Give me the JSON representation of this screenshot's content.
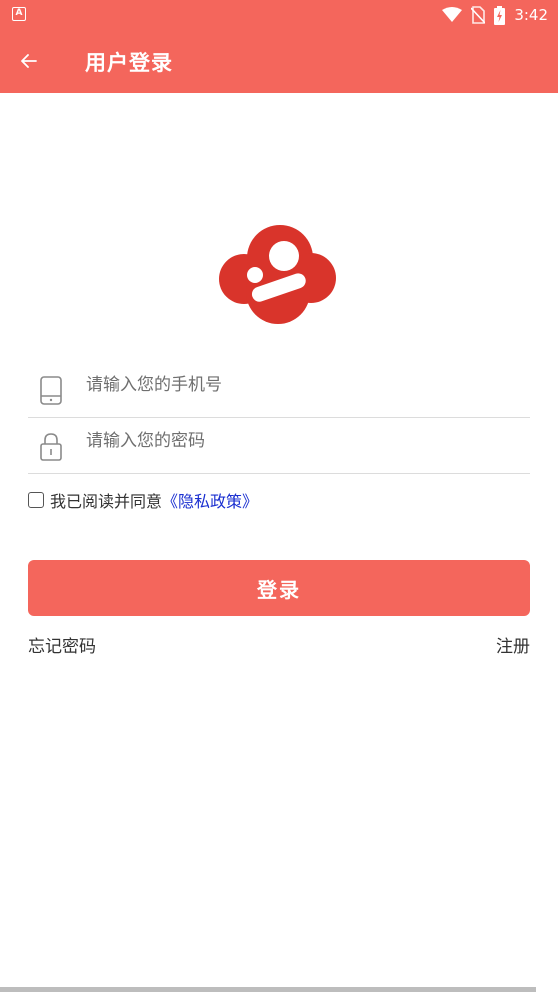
{
  "status_bar": {
    "app_icon_letter": "A",
    "time": "3:42",
    "icons": [
      "wifi-icon",
      "no-sim-icon",
      "battery-charging-icon"
    ]
  },
  "app_bar": {
    "back_icon": "arrow-left-icon",
    "title": "用户登录"
  },
  "logo": {
    "icon": "brand-cloud-logo",
    "color": "#d9342b"
  },
  "form": {
    "phone": {
      "placeholder": "请输入您的手机号",
      "value": "",
      "icon": "phone-icon"
    },
    "password": {
      "placeholder": "请输入您的密码",
      "value": "",
      "icon": "lock-icon"
    },
    "agreement": {
      "checked": false,
      "text": "我已阅读并同意",
      "policy_link": "《隐私政策》"
    },
    "login_button": "登录",
    "forgot_password": "忘记密码",
    "register": "注册"
  },
  "colors": {
    "primary": "#f4665c",
    "link": "#1a2fd0",
    "text": "#333333",
    "divider": "#dcdcdc"
  }
}
